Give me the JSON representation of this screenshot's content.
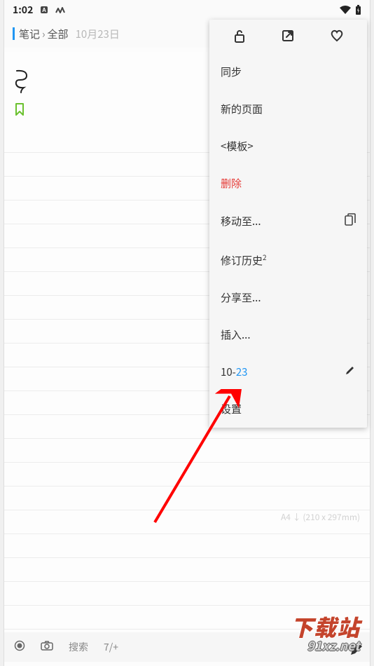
{
  "status": {
    "time": "1:02"
  },
  "breadcrumb": {
    "root": "笔记",
    "all": "全部",
    "date": "10月23日"
  },
  "menu": {
    "sync": "同步",
    "new_page": "新的页面",
    "template": "<模板>",
    "delete": "删除",
    "move_to": "移动至...",
    "revision_history": "修订历史",
    "revision_count": "2",
    "share_to": "分享至...",
    "insert": "插入...",
    "date_prefix": "10-",
    "date_day": "23",
    "settings": "设置"
  },
  "page_info": "A4  ↓ (210 x 297mm)",
  "bottom": {
    "search": "搜索",
    "zoom": "7/+"
  },
  "watermark": {
    "big": "下载站",
    "small": "91xz.net"
  }
}
